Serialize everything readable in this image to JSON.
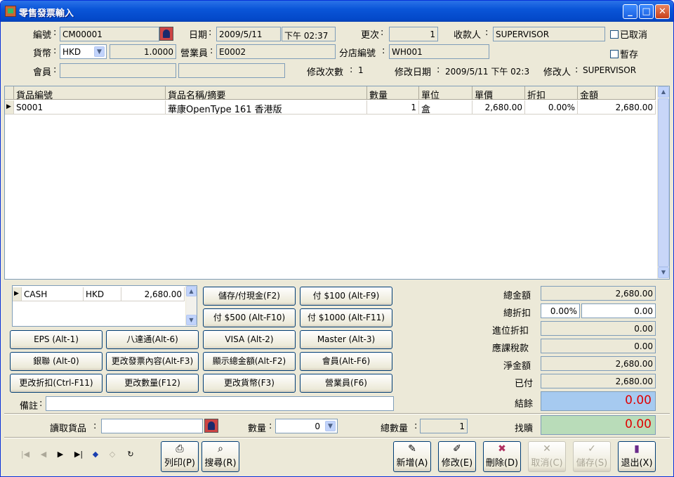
{
  "window": {
    "title": "零售發票輸入"
  },
  "header": {
    "code_label": "編號",
    "code_value": "CM00001",
    "date_label": "日期",
    "date_value": "2009/5/11",
    "time_value": "下午 02:37",
    "shift_label": "更次",
    "shift_value": "1",
    "cashier_label": "收款人",
    "cashier_value": "SUPERVISOR",
    "cancelled_label": "已取消",
    "currency_label": "貨幣",
    "currency_value": "HKD",
    "rate_value": "1.0000",
    "salesman_label": "營業員",
    "salesman_value": "E0002",
    "branch_label": "分店編號",
    "branch_value": "WH001",
    "hold_label": "暫存",
    "member_label": "會員",
    "member_value": "",
    "member_name": "",
    "revisions_label": "修改次數",
    "revisions_value": "1",
    "modify_date_label": "修改日期",
    "modify_date_value": "2009/5/11 下午 02:3",
    "modifier_label": "修改人",
    "modifier_value": "SUPERVISOR"
  },
  "items_table": {
    "columns": [
      "貨品編號",
      "貨品名稱/摘要",
      "數量",
      "單位",
      "單價",
      "折扣",
      "金額"
    ],
    "rows": [
      {
        "code": "S0001",
        "name": "華康OpenType 161 香港版",
        "qty": "1",
        "unit": "盒",
        "price": "2,680.00",
        "discount": "0.00%",
        "amount": "2,680.00"
      }
    ]
  },
  "payments": {
    "rows": [
      {
        "method": "CASH",
        "currency": "HKD",
        "amount": "2,680.00"
      }
    ]
  },
  "pay_buttons": {
    "deposit": "儲存/付現金(F2)",
    "pay100": "付 $100 (Alt-F9)",
    "pay500": "付 $500 (Alt-F10)",
    "pay1000": "付 $1000 (Alt-F11)",
    "eps": "EPS (Alt-1)",
    "octopus": "八達通(Alt-6)",
    "visa": "VISA (Alt-2)",
    "master": "Master (Alt-3)",
    "unionpay": "銀聯 (Alt-0)",
    "edit_invoice": "更改發票內容(Alt-F3)",
    "show_total": "顯示總金額(Alt-F2)",
    "member": "會員(Alt-F6)",
    "change_discount": "更改折扣(Ctrl-F11)",
    "change_qty": "更改數量(F12)",
    "change_currency": "更改貨幣(F3)",
    "salesman": "營業員(F6)"
  },
  "remarks": {
    "label": "備註",
    "value": ""
  },
  "totals": {
    "total_label": "總金額",
    "total_value": "2,680.00",
    "total_discount_label": "總折扣",
    "total_discount_pct": "0.00%",
    "total_discount_value": "0.00",
    "rounding_label": "進位折扣",
    "rounding_value": "0.00",
    "tax_label": "應課稅款",
    "tax_value": "0.00",
    "net_label": "淨金額",
    "net_value": "2,680.00",
    "paid_label": "已付",
    "paid_value": "2,680.00",
    "balance_label": "結餘",
    "balance_value": "0.00",
    "change_label": "找贖",
    "change_value": "0.00"
  },
  "scan": {
    "read_label": "讀取貨品",
    "read_value": "",
    "qty_label": "數量",
    "qty_value": "0",
    "total_qty_label": "總數量",
    "total_qty_value": "1"
  },
  "toolbar": {
    "print": "列印(P)",
    "search": "搜尋(R)",
    "add": "新增(A)",
    "edit": "修改(E)",
    "delete": "刪除(D)",
    "cancel": "取消(C)",
    "save": "儲存(S)",
    "exit": "退出(X)"
  },
  "colors": {
    "balance_bg": "#a6caf0",
    "change_bg": "#b9dcb9",
    "value_red": "#e00000",
    "title_blue": "#0a55d8"
  }
}
